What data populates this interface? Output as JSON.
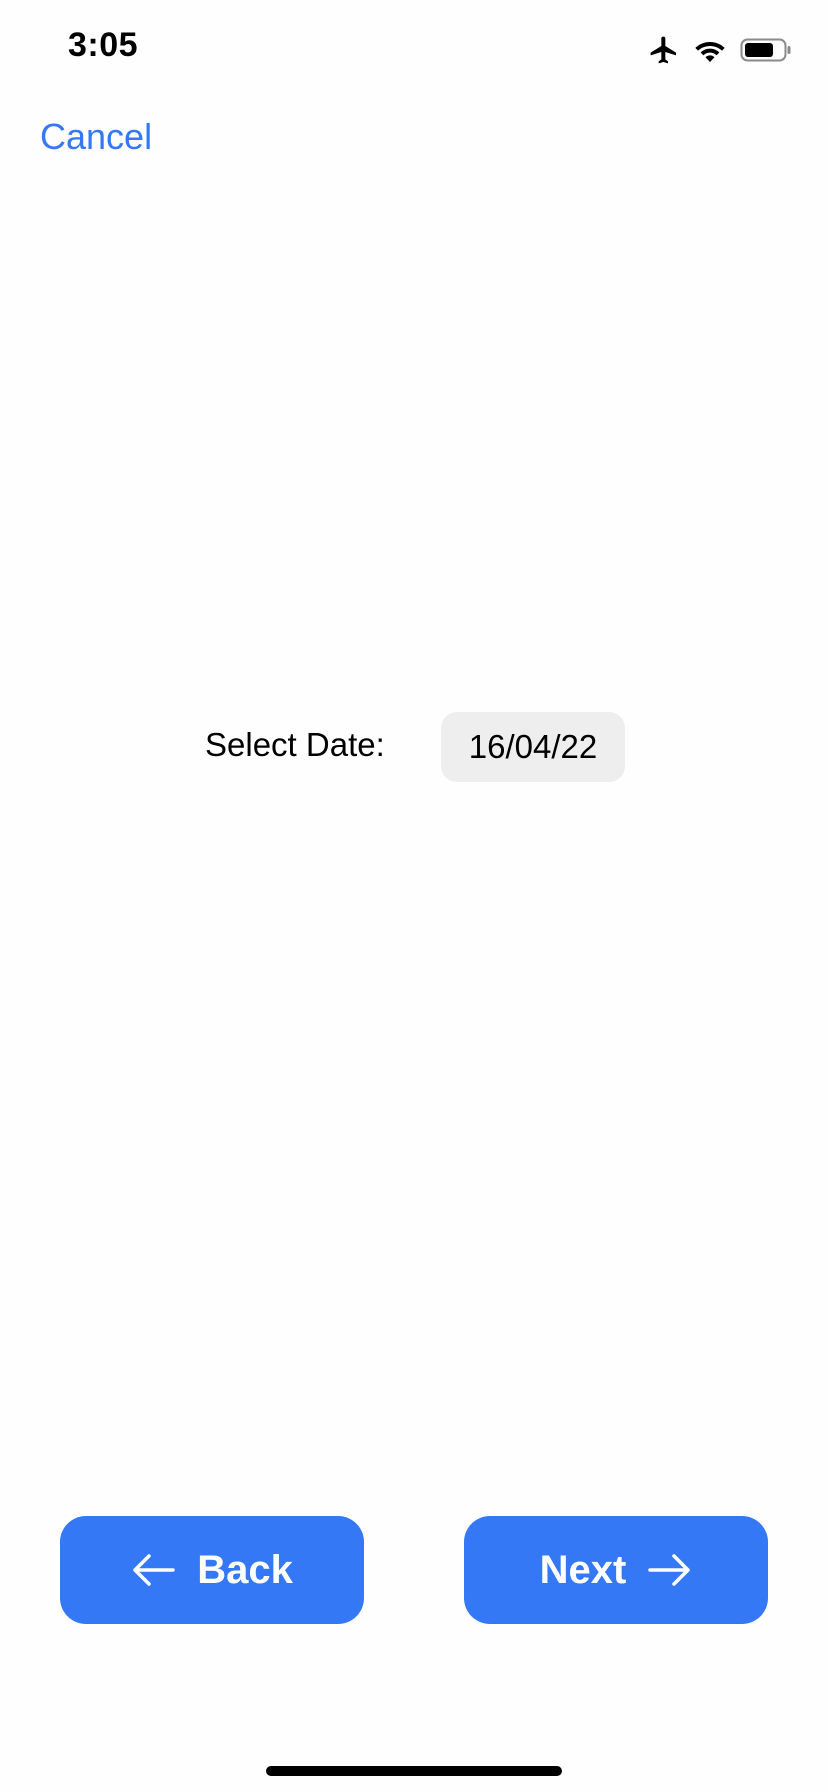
{
  "status_bar": {
    "time": "3:05",
    "icons": [
      "airplane-icon",
      "wifi-icon",
      "battery-icon"
    ]
  },
  "header": {
    "cancel_label": "Cancel"
  },
  "form": {
    "date_label": "Select Date:",
    "date_value": "16/04/22"
  },
  "footer": {
    "back_label": "Back",
    "next_label": "Next"
  },
  "colors": {
    "accent": "#3478f6",
    "date_pill_bg": "#eeeeef"
  }
}
